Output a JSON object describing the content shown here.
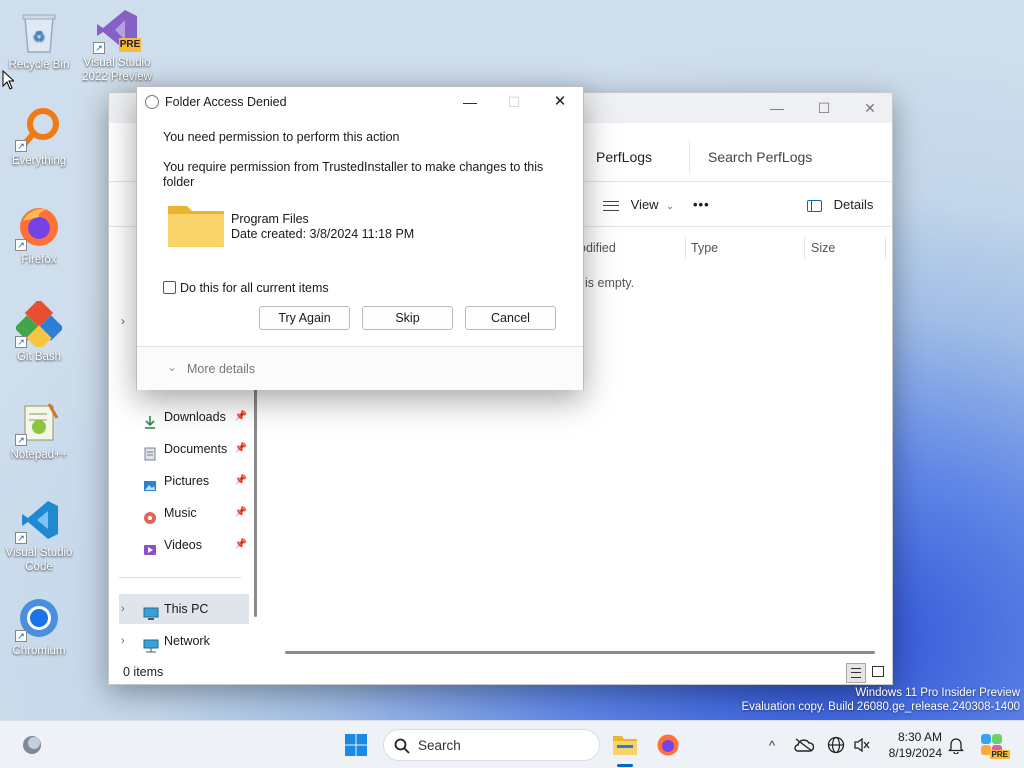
{
  "desktop": {
    "icons": [
      {
        "label": "Recycle Bin"
      },
      {
        "label": "Visual Studio 2022 Preview",
        "badge": "PRE"
      },
      {
        "label": "Everything"
      },
      {
        "label": "Firefox"
      },
      {
        "label": "Git Bash"
      },
      {
        "label": "Notepad++"
      },
      {
        "label": "Visual Studio Code"
      },
      {
        "label": "Chromium"
      }
    ]
  },
  "explorer": {
    "breadcrumb": "PerfLogs",
    "search_placeholder": "Search PerfLogs",
    "view_label": "View",
    "more_label": "•••",
    "details_label": "Details",
    "columns": [
      "odified",
      "Type",
      "Size"
    ],
    "empty_message": "is empty.",
    "sidebar": {
      "quick_access": [
        {
          "label": "Downloads"
        },
        {
          "label": "Documents"
        },
        {
          "label": "Pictures"
        },
        {
          "label": "Music"
        },
        {
          "label": "Videos"
        }
      ],
      "this_pc": "This PC",
      "network": "Network"
    },
    "status": "0 items"
  },
  "dialog": {
    "title": "Folder Access Denied",
    "line1": "You need permission to perform this action",
    "line2a": "You require permission from TrustedInstaller to make changes to this",
    "line2b": "folder",
    "item_name": "Program Files",
    "item_date": "Date created: 3/8/2024 11:18 PM",
    "checkbox_label": "Do this for all current items",
    "buttons": {
      "try_again": "Try Again",
      "skip": "Skip",
      "cancel": "Cancel"
    },
    "more_details": "More details"
  },
  "watermark": {
    "line1": "Windows 11 Pro Insider Preview",
    "line2": "Evaluation copy. Build 26080.ge_release.240308-1400"
  },
  "taskbar": {
    "search_label": "Search",
    "time": "8:30 AM",
    "date": "8/19/2024",
    "copilot_badge": "PRE"
  },
  "colors": {
    "accent": "#0067c0",
    "folder": "#f5c342"
  }
}
